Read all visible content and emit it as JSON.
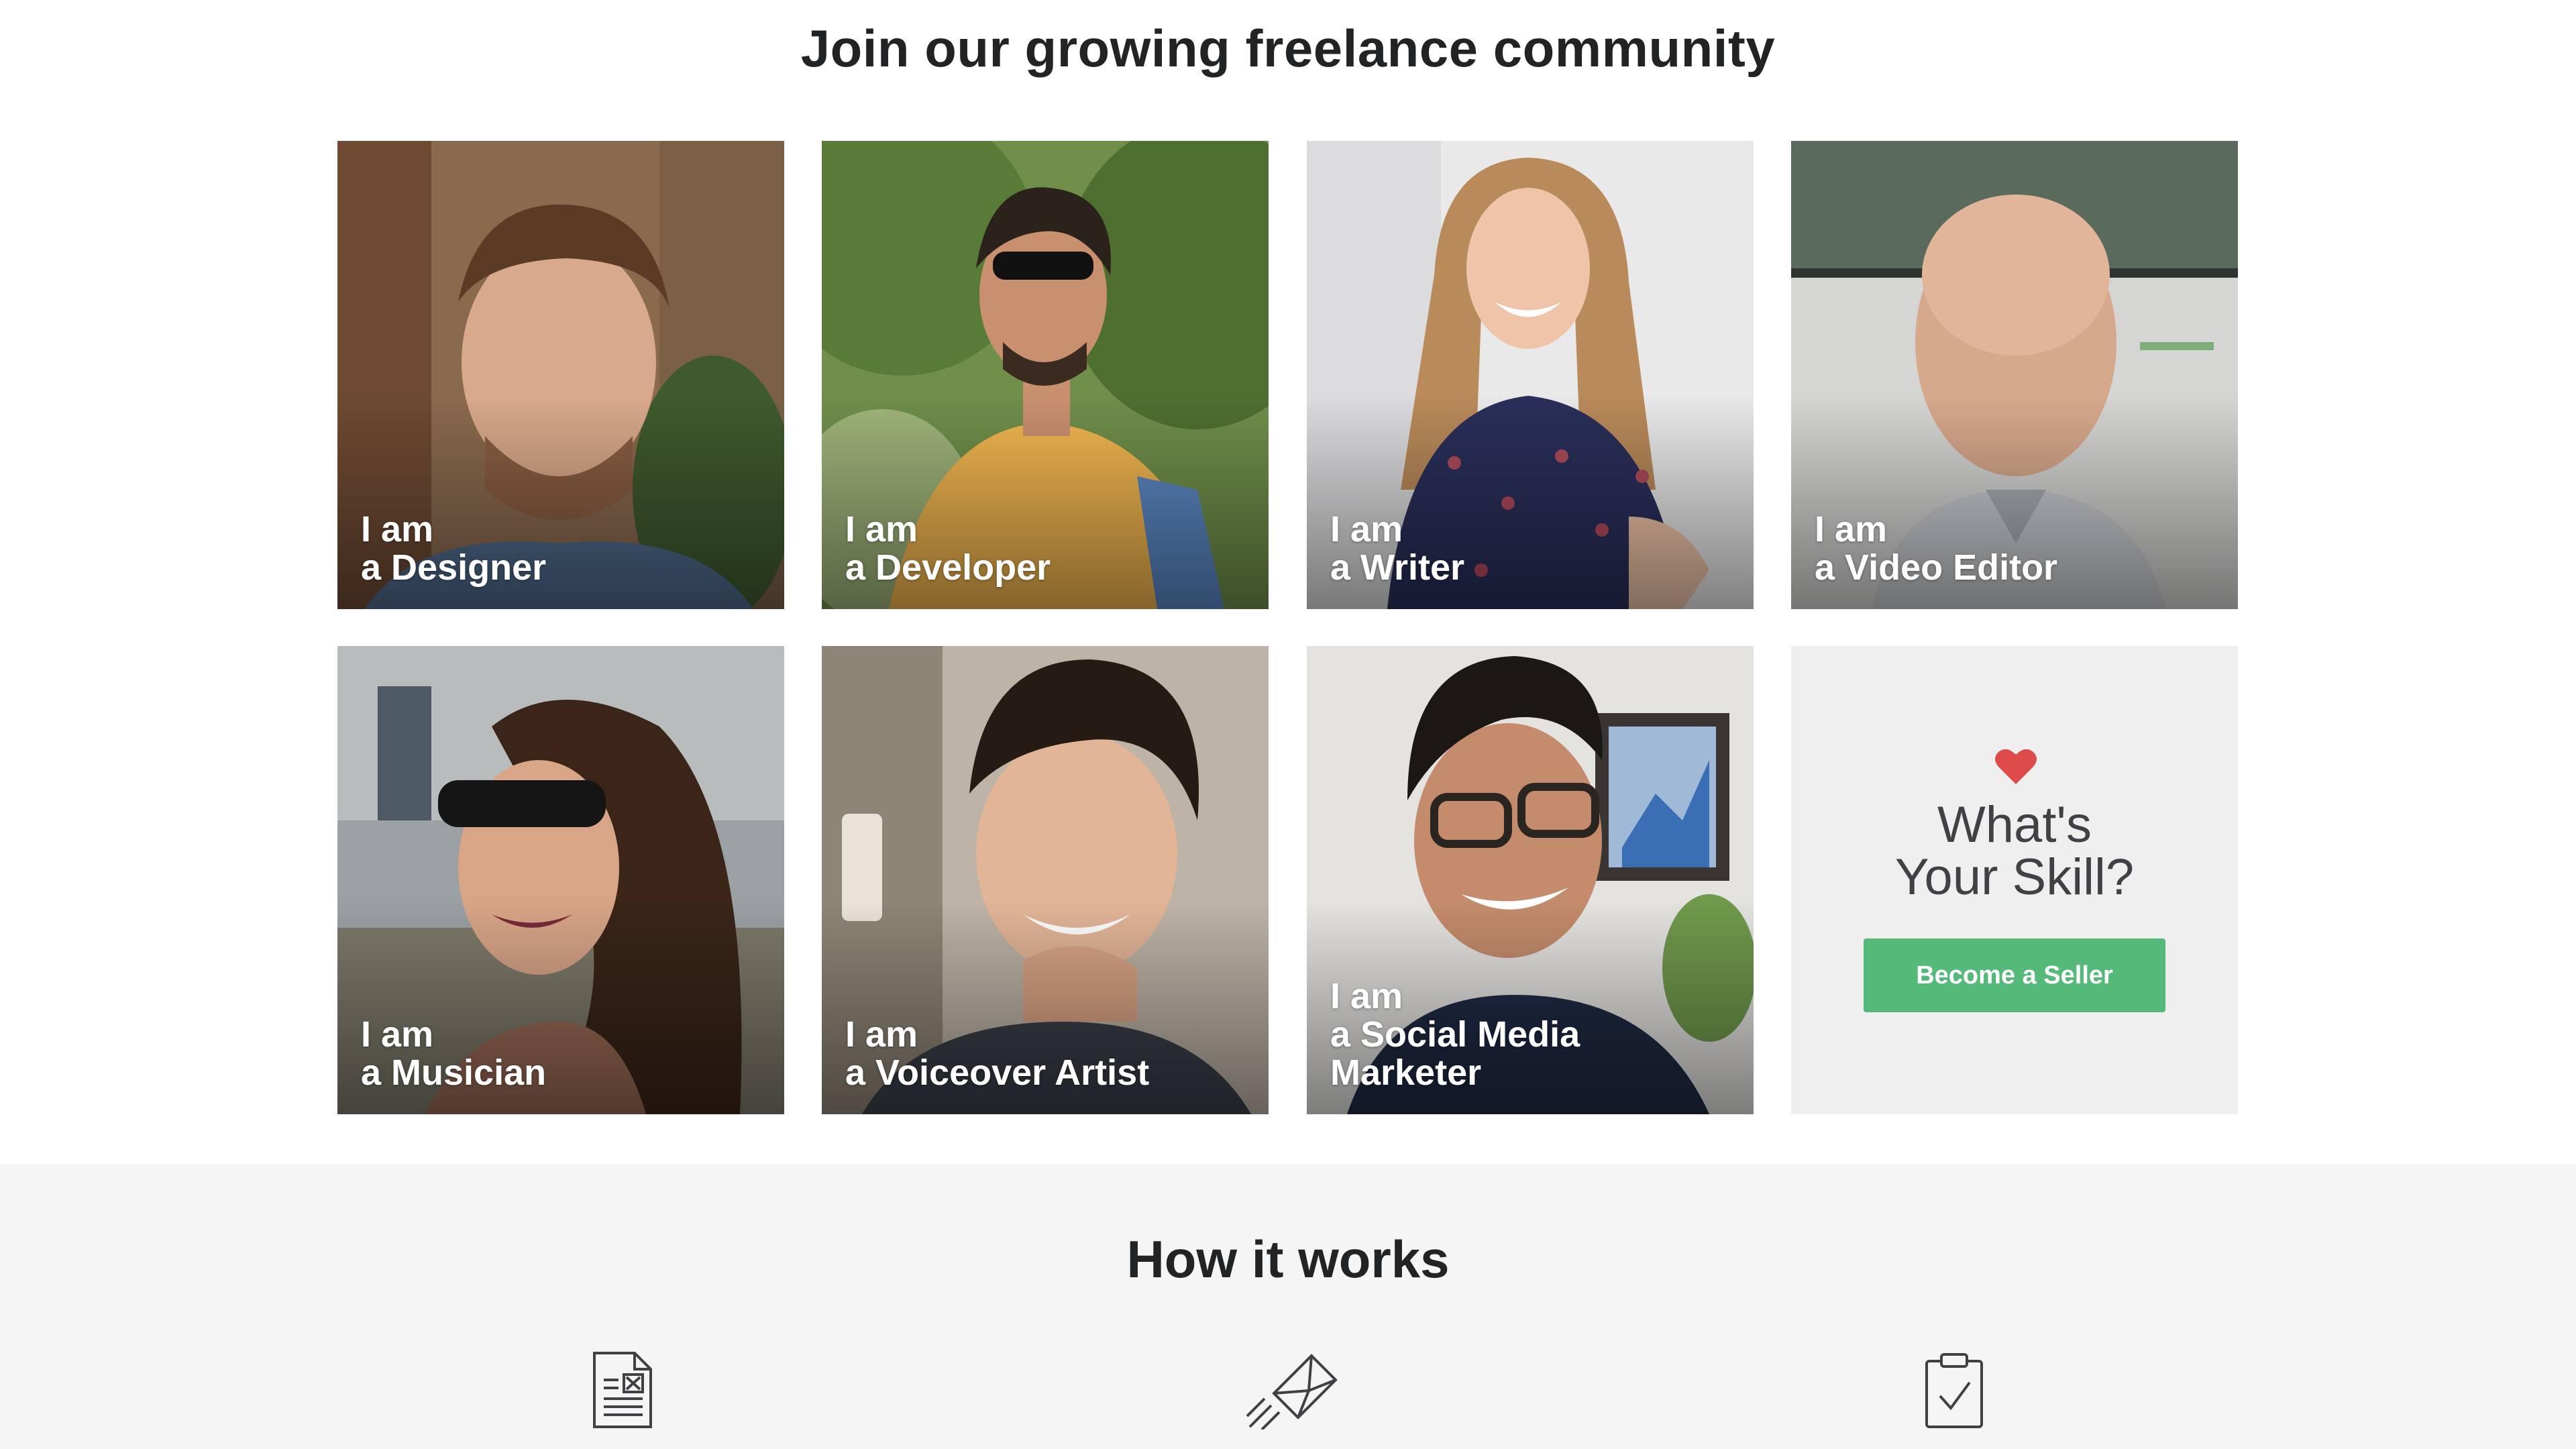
{
  "community": {
    "title": "Join our growing freelance community",
    "tiles": [
      {
        "line1": "I am",
        "line2": "a Designer",
        "line3": ""
      },
      {
        "line1": "I am",
        "line2": "a Developer",
        "line3": ""
      },
      {
        "line1": "I am",
        "line2": "a Writer",
        "line3": ""
      },
      {
        "line1": "I am",
        "line2": "a Video Editor",
        "line3": ""
      },
      {
        "line1": "I am",
        "line2": "a Musician",
        "line3": ""
      },
      {
        "line1": "I am",
        "line2": "a Voiceover Artist",
        "line3": ""
      },
      {
        "line1": "I am",
        "line2": "a Social Media",
        "line3": "Marketer"
      }
    ],
    "skill_card": {
      "line1": "What's",
      "line2": "Your Skill?",
      "button": "Become a Seller"
    }
  },
  "how_it_works": {
    "title": "How it works",
    "icons": [
      "document-form-icon",
      "paper-plane-envelope-icon",
      "clipboard-check-icon"
    ]
  },
  "colors": {
    "accent_green": "#55b97a",
    "heart_red": "#dd4b4b",
    "title_text": "#222325",
    "section_bg": "#f5f5f5",
    "skill_bg": "#efeff0"
  }
}
